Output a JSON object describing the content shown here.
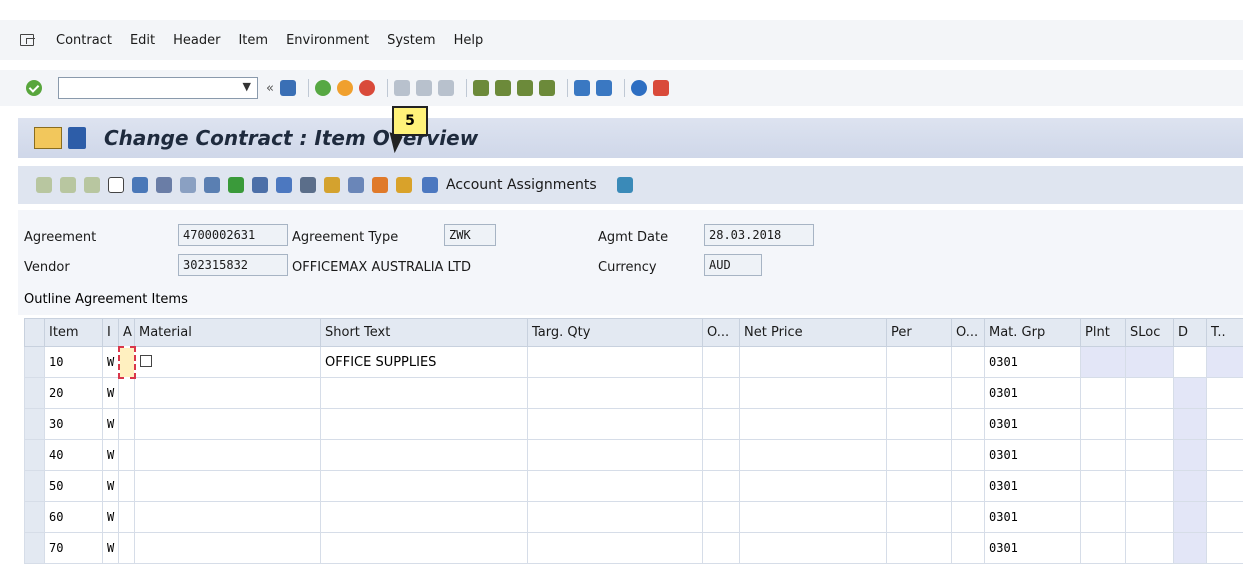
{
  "menu": {
    "items": [
      "Contract",
      "Edit",
      "Header",
      "Item",
      "Environment",
      "System",
      "Help"
    ]
  },
  "toolbar": {
    "command_value": ""
  },
  "title": {
    "text": "Change Contract : Item Overview"
  },
  "app_toolbar": {
    "account_assignments_label": "Account Assignments"
  },
  "callout": {
    "number": "5"
  },
  "header": {
    "agreement_label": "Agreement",
    "agreement_value": "4700002631",
    "agreement_type_label": "Agreement Type",
    "agreement_type_value": "ZWK",
    "agmt_date_label": "Agmt Date",
    "agmt_date_value": "28.03.2018",
    "vendor_label": "Vendor",
    "vendor_value": "302315832",
    "vendor_name": "OFFICEMAX AUSTRALIA LTD",
    "currency_label": "Currency",
    "currency_value": "AUD"
  },
  "items_section": {
    "label": "Outline Agreement Items",
    "columns": [
      "Item",
      "I",
      "A",
      "Material",
      "Short Text",
      "Targ. Qty",
      "O...",
      "Net Price",
      "Per",
      "O...",
      "Mat. Grp",
      "Plnt",
      "SLoc",
      "D",
      "T.."
    ],
    "rows": [
      {
        "item": "10",
        "i": "W",
        "a": "",
        "material": "",
        "short_text": "OFFICE SUPPLIES",
        "mat_grp": "0301"
      },
      {
        "item": "20",
        "i": "W",
        "a": "",
        "material": "",
        "short_text": "",
        "mat_grp": "0301"
      },
      {
        "item": "30",
        "i": "W",
        "a": "",
        "material": "",
        "short_text": "",
        "mat_grp": "0301"
      },
      {
        "item": "40",
        "i": "W",
        "a": "",
        "material": "",
        "short_text": "",
        "mat_grp": "0301"
      },
      {
        "item": "50",
        "i": "W",
        "a": "",
        "material": "",
        "short_text": "",
        "mat_grp": "0301"
      },
      {
        "item": "60",
        "i": "W",
        "a": "",
        "material": "",
        "short_text": "",
        "mat_grp": "0301"
      },
      {
        "item": "70",
        "i": "W",
        "a": "",
        "material": "",
        "short_text": "",
        "mat_grp": "0301"
      }
    ]
  }
}
